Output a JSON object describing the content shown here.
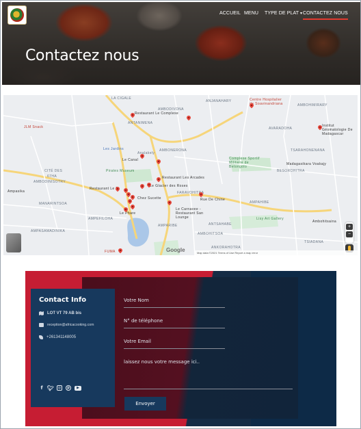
{
  "header": {
    "nav": [
      {
        "label": "ACCUEIL"
      },
      {
        "label": "MENU"
      },
      {
        "label": "TYPE DE PLAT"
      },
      {
        "label": "CONTACTEZ NOUS"
      }
    ],
    "dropdown_caret": "▾",
    "accent_color": "#e23a2f"
  },
  "hero": {
    "title": "Contactez nous"
  },
  "map": {
    "labels": {
      "la_cigale": "LA CIGALE",
      "anjanahary": "ANJANAHARY",
      "ambodivona": "AMBODIVONA",
      "antanimena": "ANTANIMENA",
      "ambohimirary": "AMBOHIMIRARY",
      "avaradoha": "AVARADOHA",
      "ambonerona": "AMBONERONA",
      "tsarahonenana": "TSARAHONENANA",
      "cite_des": "CITÉ DES",
      "67ha": "67HA",
      "ambodinisotry": "AMBODINISOTRY",
      "manarintsoa": "MANARINTSOA",
      "faravohitra": "FARAVOHITRA",
      "ampahibe": "AMPAHIBE",
      "ampefiloha": "AMPEFILOHA",
      "antsahabe": "ANTSAHABE",
      "ampasamadinika": "AMPASAMADINIKA",
      "amparibe": "AMPARIBE",
      "ambohitsoa": "AMBOHITSOA",
      "tsiadana": "TSIADANA",
      "ankorahotra": "ANKORAHOTRA",
      "ambohitsaina": "Ambohitsaina",
      "ampasika": "Ampasika",
      "besorohitra": "BESOROHITRA",
      "centre_hosp": "Centre Hospitalier de Soavinandriana",
      "restaurant_le_complexe": "Restaurant Le Complexe",
      "institut": "Institut Géomatologie De Madagascar",
      "jlm_snack": "JLM Snack",
      "complexe_sportif": "Complexe Sportif Militaire de Betongolo",
      "madagasikara_voakajy": "Madagasikara Voakajy",
      "lecanal": "Le Canal",
      "restaurant_les_arcades": "Restaurant Les Arcades",
      "restaurant_le_b": "Restaurant Le B",
      "le_glacier": "Le Glacier des Roses",
      "chez_sucette": "Chez Sucette",
      "rue_de_chine": "Rue De Chine",
      "le_carnavee": "Le Carnavee - Restaurant San Lounge",
      "le_phare": "Le Phare",
      "lisy_art": "Lisy Art Gallery",
      "pieces_museum": "Pirates Museum",
      "les_jardins": "Les Jardins",
      "analakely": "Analakely",
      "fuma": "FUMA",
      "google": "Google",
      "attribution": "Map data ©2021  Terms of Use  Report a map error"
    }
  },
  "contact": {
    "title": "Contact Info",
    "address": "LOT VT 79 AB bis",
    "email": "reception@africacooking.com",
    "phone": "+261341148005",
    "socials": [
      "facebook-icon",
      "twitter-icon",
      "instagram-icon",
      "pinterest-icon",
      "youtube-icon"
    ],
    "form": {
      "name_placeholder": "Votre Nom",
      "phone_placeholder": "N° de téléphone",
      "email_placeholder": "Votre Email",
      "message_placeholder": "laissez nous votre message ici..",
      "submit_label": "Envoyer"
    },
    "colors": {
      "red": "#c61d33",
      "navy": "#17395d",
      "dark_navy": "#0d2a47"
    }
  }
}
